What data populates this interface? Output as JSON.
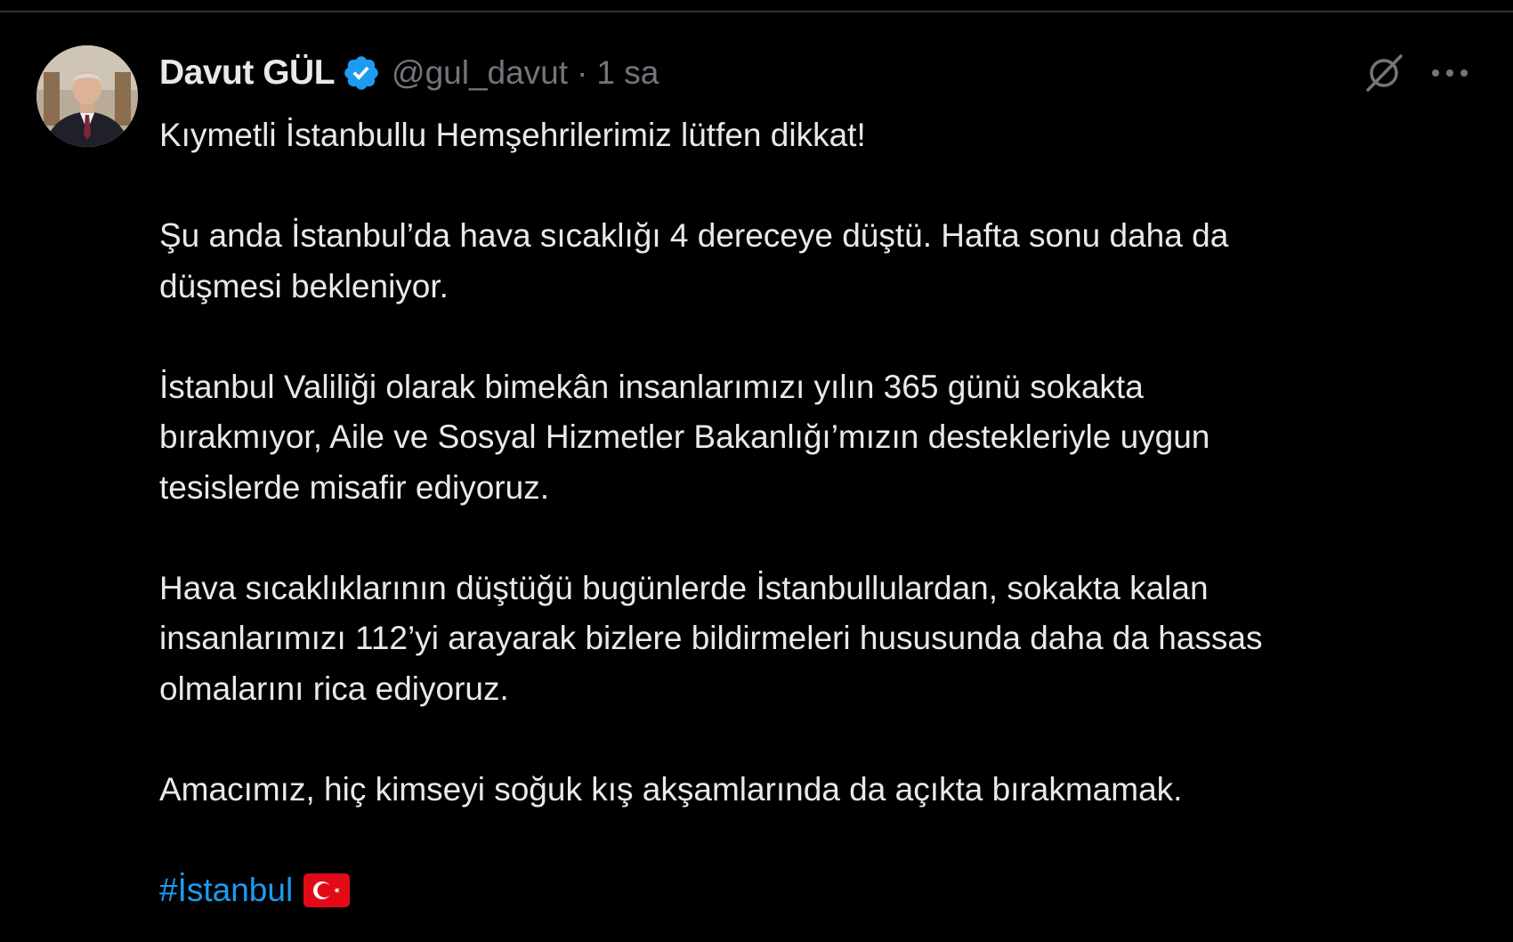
{
  "tweet": {
    "author": {
      "display_name": "Davut GÜL",
      "handle": "@gul_davut",
      "verified": true,
      "verified_color": "#1d9bf0",
      "avatar_icon": "profile-photo"
    },
    "separator": "·",
    "timestamp": "1 sa",
    "actions": {
      "grok_icon": "grok-icon",
      "more_icon": "more-options-icon"
    },
    "paragraphs": [
      "Kıymetli İstanbullu Hemşehrilerimiz lütfen dikkat!",
      "Şu anda İstanbul’da hava sıcaklığı 4 dereceye düştü. Hafta sonu daha da\ndüşmesi bekleniyor.",
      "İstanbul Valiliği olarak bimekân insanlarımızı yılın 365 günü sokakta\nbırakmıyor, Aile ve Sosyal Hizmetler Bakanlığı’mızın destekleriyle uygun\ntesislerde misafir ediyoruz.",
      "Hava sıcaklıklarının düştüğü bugünlerde İstanbullulardan, sokakta kalan\ninsanlarımızı 112’yi arayarak bizlere bildirmeleri hususunda daha da hassas\nolmalarını rica ediyoruz.",
      "Amacımız, hiç kimseyi soğuk kış akşamlarında da açıkta bırakmamak."
    ],
    "hashtag": "#İstanbul",
    "flag_icon": "turkey-flag-emoji",
    "colors": {
      "background": "#000000",
      "text": "#e7e9ea",
      "secondary": "#71767b",
      "link": "#1d9bf0",
      "flag_red": "#e30a17"
    }
  }
}
